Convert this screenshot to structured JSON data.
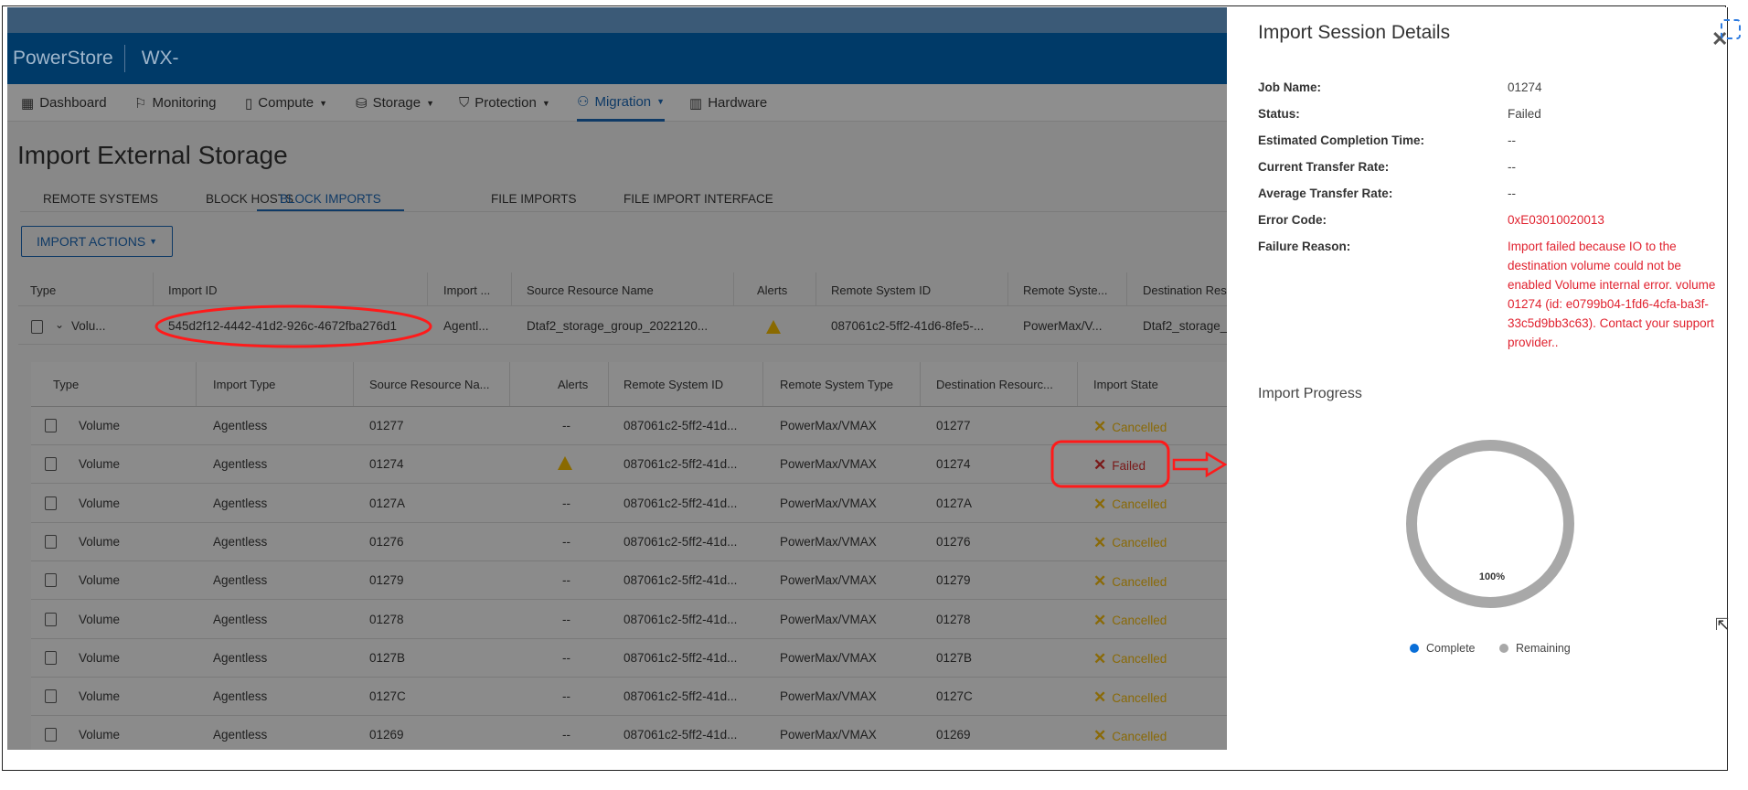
{
  "header": {
    "brand": "PowerStore",
    "cluster": "WX-"
  },
  "nav": [
    {
      "label": "Dashboard",
      "icon": "dashboard-icon",
      "glyph": "▦",
      "caret": false
    },
    {
      "label": "Monitoring",
      "icon": "flag-icon",
      "glyph": "⚐",
      "caret": false
    },
    {
      "label": "Compute",
      "icon": "server-icon",
      "glyph": "▯",
      "caret": true
    },
    {
      "label": "Storage",
      "icon": "database-icon",
      "glyph": "⛁",
      "caret": true
    },
    {
      "label": "Protection",
      "icon": "shield-icon",
      "glyph": "⛉",
      "caret": true
    },
    {
      "label": "Migration",
      "icon": "migration-icon",
      "glyph": "⚇",
      "caret": true,
      "active": true
    },
    {
      "label": "Hardware",
      "icon": "hardware-icon",
      "glyph": "▥",
      "caret": false
    }
  ],
  "page": {
    "title": "Import External Storage"
  },
  "tabs": [
    {
      "label": "REMOTE SYSTEMS"
    },
    {
      "label": "BLOCK HOSTS"
    },
    {
      "label": "BLOCK IMPORTS",
      "active": true
    },
    {
      "label": "FILE IMPORTS"
    },
    {
      "label": "FILE IMPORT INTERFACE"
    }
  ],
  "import_actions": "IMPORT ACTIONS",
  "parent_table": {
    "columns": [
      "Type",
      "Import ID",
      "Import ...",
      "Source Resource Name",
      "Alerts",
      "Remote System ID",
      "Remote Syste...",
      "Destination Res"
    ],
    "row": {
      "type": "Volu...",
      "import_id": "545d2f12-4442-41d2-926c-4672fba276d1",
      "import_type": "Agentl...",
      "source": "Dtaf2_storage_group_2022120...",
      "alert": "warning",
      "remote_id": "087061c2-5ff2-41d6-8fe5-...",
      "remote_type": "PowerMax/V...",
      "destination": "Dtaf2_storage_"
    }
  },
  "child_table": {
    "columns": [
      "Type",
      "Import Type",
      "Source Resource Na...",
      "Alerts",
      "Remote System ID",
      "Remote System Type",
      "Destination Resourc...",
      "Import State"
    ],
    "rows": [
      {
        "type": "Volume",
        "import_type": "Agentless",
        "source": "01277",
        "alerts": "--",
        "remote_id": "087061c2-5ff2-41d...",
        "remote_type": "PowerMax/VMAX",
        "destination": "01277",
        "state": "Cancelled"
      },
      {
        "type": "Volume",
        "import_type": "Agentless",
        "source": "01274",
        "alerts": "warning",
        "remote_id": "087061c2-5ff2-41d...",
        "remote_type": "PowerMax/VMAX",
        "destination": "01274",
        "state": "Failed"
      },
      {
        "type": "Volume",
        "import_type": "Agentless",
        "source": "0127A",
        "alerts": "--",
        "remote_id": "087061c2-5ff2-41d...",
        "remote_type": "PowerMax/VMAX",
        "destination": "0127A",
        "state": "Cancelled"
      },
      {
        "type": "Volume",
        "import_type": "Agentless",
        "source": "01276",
        "alerts": "--",
        "remote_id": "087061c2-5ff2-41d...",
        "remote_type": "PowerMax/VMAX",
        "destination": "01276",
        "state": "Cancelled"
      },
      {
        "type": "Volume",
        "import_type": "Agentless",
        "source": "01279",
        "alerts": "--",
        "remote_id": "087061c2-5ff2-41d...",
        "remote_type": "PowerMax/VMAX",
        "destination": "01279",
        "state": "Cancelled"
      },
      {
        "type": "Volume",
        "import_type": "Agentless",
        "source": "01278",
        "alerts": "--",
        "remote_id": "087061c2-5ff2-41d...",
        "remote_type": "PowerMax/VMAX",
        "destination": "01278",
        "state": "Cancelled"
      },
      {
        "type": "Volume",
        "import_type": "Agentless",
        "source": "0127B",
        "alerts": "--",
        "remote_id": "087061c2-5ff2-41d...",
        "remote_type": "PowerMax/VMAX",
        "destination": "0127B",
        "state": "Cancelled"
      },
      {
        "type": "Volume",
        "import_type": "Agentless",
        "source": "0127C",
        "alerts": "--",
        "remote_id": "087061c2-5ff2-41d...",
        "remote_type": "PowerMax/VMAX",
        "destination": "0127C",
        "state": "Cancelled"
      },
      {
        "type": "Volume",
        "import_type": "Agentless",
        "source": "01269",
        "alerts": "--",
        "remote_id": "087061c2-5ff2-41d...",
        "remote_type": "PowerMax/VMAX",
        "destination": "01269",
        "state": "Cancelled"
      }
    ]
  },
  "panel": {
    "title": "Import Session Details",
    "fields": [
      {
        "label": "Job Name:",
        "value": "01274"
      },
      {
        "label": "Status:",
        "value": "Failed"
      },
      {
        "label": "Estimated Completion Time:",
        "value": "--"
      },
      {
        "label": "Current Transfer Rate:",
        "value": "--"
      },
      {
        "label": "Average Transfer Rate:",
        "value": "--"
      },
      {
        "label": "Error Code:",
        "value": "0xE03010020013",
        "error": true
      },
      {
        "label": "Failure Reason:",
        "value": "Import failed because IO to the destination volume could not be enabled Volume internal error. volume 01274 (id: e0799b04-1fd6-4cfa-ba3f-33c5d9bb3c63). Contact your support provider..",
        "error": true
      }
    ],
    "progress_title": "Import Progress",
    "progress": {
      "label": "100%",
      "complete_percent": 0,
      "remaining_percent": 100,
      "legend": [
        {
          "name": "Complete",
          "color": "#0a6fd8"
        },
        {
          "name": "Remaining",
          "color": "#a8a8a8"
        }
      ]
    }
  },
  "colors": {
    "error": "#e0222f",
    "annotation": "#ff1a1a",
    "header": "#003a68"
  }
}
